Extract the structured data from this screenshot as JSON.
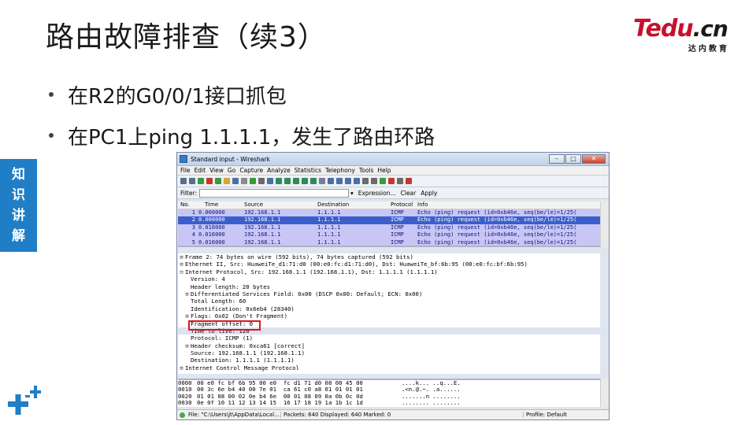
{
  "slide": {
    "title": "路由故障排查（续3）",
    "bullets": [
      "在R2的G0/0/1接口抓包",
      "在PC1上ping 1.1.1.1，发生了路由环路"
    ],
    "side_tag": [
      "知",
      "识",
      "讲",
      "解"
    ],
    "logo": {
      "main": "Tedu",
      "suffix": ".cn",
      "sub": "达内教育"
    },
    "colors": {
      "brand_red": "#c8102e",
      "side_blue": "#1f7ec6",
      "highlight_red": "#e0141c"
    }
  },
  "wireshark": {
    "window_title": "Standard input - Wireshark",
    "menu": [
      "File",
      "Edit",
      "View",
      "Go",
      "Capture",
      "Analyze",
      "Statistics",
      "Telephony",
      "Tools",
      "Help"
    ],
    "filter": {
      "label": "Filter:",
      "expression": "Expression...",
      "clear": "Clear",
      "apply": "Apply"
    },
    "columns": [
      "No.",
      "Time",
      "Source",
      "Destination",
      "Protocol",
      "Info"
    ],
    "packets": [
      {
        "no": "1",
        "time": "0.000000",
        "src": "192.168.1.1",
        "dst": "1.1.1.1",
        "proto": "ICMP",
        "info": "Echo (ping) request  (id=0xb46e, seq(be/le)=1/25("
      },
      {
        "no": "2",
        "time": "0.000000",
        "src": "192.168.1.1",
        "dst": "1.1.1.1",
        "proto": "ICMP",
        "info": "Echo (ping) request  (id=0xb46e, seq(be/le)=1/25("
      },
      {
        "no": "3",
        "time": "0.016000",
        "src": "192.168.1.1",
        "dst": "1.1.1.1",
        "proto": "ICMP",
        "info": "Echo (ping) request  (id=0xb46e, seq(be/le)=1/25("
      },
      {
        "no": "4",
        "time": "0.016000",
        "src": "192.168.1.1",
        "dst": "1.1.1.1",
        "proto": "ICMP",
        "info": "Echo (ping) request  (id=0xb46e, seq(be/le)=1/25("
      },
      {
        "no": "5",
        "time": "0.016000",
        "src": "192.168.1.1",
        "dst": "1.1.1.1",
        "proto": "ICMP",
        "info": "Echo (ping) request  (id=0xb46e, seq(be/le)=1/25("
      }
    ],
    "details": [
      {
        "exp": "⊞",
        "indent": false,
        "text": "Frame 2: 74 bytes on wire (592 bits), 74 bytes captured (592 bits)"
      },
      {
        "exp": "⊞",
        "indent": false,
        "text": "Ethernet II, Src: HuaweiTe_d1:71:d0 (00:e0:fc:d1:71:d0), Dst: HuaweiTe_bf:6b:95 (00:e0:fc:bf:6b:95)"
      },
      {
        "exp": "⊟",
        "indent": false,
        "text": "Internet Protocol, Src: 192.168.1.1 (192.168.1.1), Dst: 1.1.1.1 (1.1.1.1)"
      },
      {
        "exp": "",
        "indent": true,
        "text": "Version: 4"
      },
      {
        "exp": "",
        "indent": true,
        "text": "Header length: 20 bytes"
      },
      {
        "exp": "⊞",
        "indent": true,
        "text": "Differentiated Services Field: 0x00 (DSCP 0x00: Default; ECN: 0x00)"
      },
      {
        "exp": "",
        "indent": true,
        "text": "Total Length: 60"
      },
      {
        "exp": "",
        "indent": true,
        "text": "Identification: 0x6eb4 (28340)"
      },
      {
        "exp": "⊞",
        "indent": true,
        "text": "Flags: 0x02 (Don't Fragment)"
      },
      {
        "exp": "",
        "indent": true,
        "text": "Fragment offset: 0"
      },
      {
        "exp": "",
        "indent": true,
        "text": "Time to live: 126"
      },
      {
        "exp": "",
        "indent": true,
        "text": "Protocol: ICMP (1)"
      },
      {
        "exp": "⊞",
        "indent": true,
        "text": "Header checksum: 0xca61 [correct]"
      },
      {
        "exp": "",
        "indent": true,
        "text": "Source: 192.168.1.1 (192.168.1.1)"
      },
      {
        "exp": "",
        "indent": true,
        "text": "Destination: 1.1.1.1 (1.1.1.1)"
      },
      {
        "exp": "⊞",
        "indent": false,
        "text": "Internet Control Message Protocol"
      }
    ],
    "hex": [
      {
        "off": "0000",
        "hex": "00 e0 fc bf 6b 95 00 e0  fc d1 71 d0 08 00 45 00",
        "ascii": "....k... ..q...E."
      },
      {
        "off": "0010",
        "hex": "00 3c 6e b4 40 00 7e 01  ca 61 c0 a8 01 01 01 01",
        "ascii": ".<n.@.~. .a......"
      },
      {
        "off": "0020",
        "hex": "01 01 08 00 02 0e b4 6e  00 01 08 09 0a 0b 0c 0d",
        "ascii": ".......n ........"
      },
      {
        "off": "0030",
        "hex": "0e 0f 10 11 12 13 14 15  16 17 18 19 1a 1b 1c 1d",
        "ascii": "........ ........"
      }
    ],
    "status": {
      "file": "File: \"C:\\Users\\jt\\AppData\\Local...",
      "packets": "Packets: 640 Displayed: 640 Marked: 0",
      "profile": "Profile: Default"
    }
  }
}
